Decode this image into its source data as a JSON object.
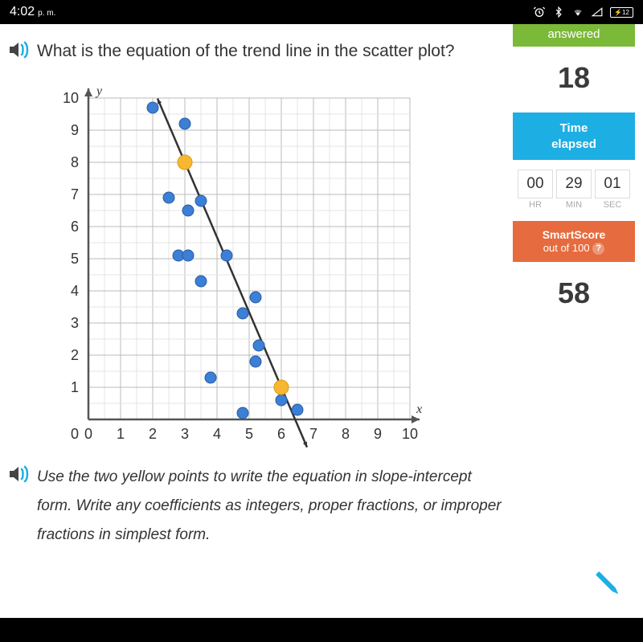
{
  "status": {
    "time": "4:02",
    "ampm": "p. m.",
    "battery": "12"
  },
  "question": {
    "main": "What is the equation of the trend line in the scatter plot?",
    "instruction": "Use the two yellow points to write the equation in slope-intercept form. Write any coefficients as integers, proper fractions, or improper fractions in simplest form."
  },
  "sidebar": {
    "answered_label": "answered",
    "answered_count": "18",
    "time_label_1": "Time",
    "time_label_2": "elapsed",
    "time": {
      "hr": "00",
      "min": "29",
      "sec": "01"
    },
    "time_units": {
      "hr": "HR",
      "min": "MIN",
      "sec": "SEC"
    },
    "smartscore_label": "SmartScore",
    "smartscore_sub": "out of 100",
    "smartscore_value": "58",
    "help": "?"
  },
  "chart_data": {
    "type": "scatter",
    "title": "",
    "xlabel": "x",
    "ylabel": "y",
    "xlim": [
      0,
      10
    ],
    "ylim": [
      0,
      10
    ],
    "x_ticks": [
      0,
      1,
      2,
      3,
      4,
      5,
      6,
      7,
      8,
      9,
      10
    ],
    "y_ticks": [
      1,
      2,
      3,
      4,
      5,
      6,
      7,
      8,
      9,
      10
    ],
    "grid": true,
    "series": [
      {
        "name": "data-points",
        "color": "#3b7fd6",
        "points": [
          {
            "x": 2,
            "y": 9.7
          },
          {
            "x": 3,
            "y": 9.2
          },
          {
            "x": 2.5,
            "y": 6.9
          },
          {
            "x": 3.1,
            "y": 6.5
          },
          {
            "x": 3.5,
            "y": 6.8
          },
          {
            "x": 2.8,
            "y": 5.1
          },
          {
            "x": 3.1,
            "y": 5.1
          },
          {
            "x": 4.3,
            "y": 5.1
          },
          {
            "x": 3.5,
            "y": 4.3
          },
          {
            "x": 5.2,
            "y": 3.8
          },
          {
            "x": 3.8,
            "y": 1.3
          },
          {
            "x": 4.8,
            "y": 3.3
          },
          {
            "x": 5.3,
            "y": 2.3
          },
          {
            "x": 5.2,
            "y": 1.8
          },
          {
            "x": 4.8,
            "y": 0.2
          },
          {
            "x": 6.0,
            "y": 0.6
          },
          {
            "x": 6.5,
            "y": 0.3
          }
        ]
      },
      {
        "name": "highlighted-points",
        "color": "#f7b731",
        "points": [
          {
            "x": 3,
            "y": 8
          },
          {
            "x": 6,
            "y": 1
          }
        ]
      }
    ],
    "trend_line": {
      "slope": -2.333,
      "intercept": 15,
      "through": [
        {
          "x": 3,
          "y": 8
        },
        {
          "x": 6,
          "y": 1
        }
      ]
    }
  }
}
